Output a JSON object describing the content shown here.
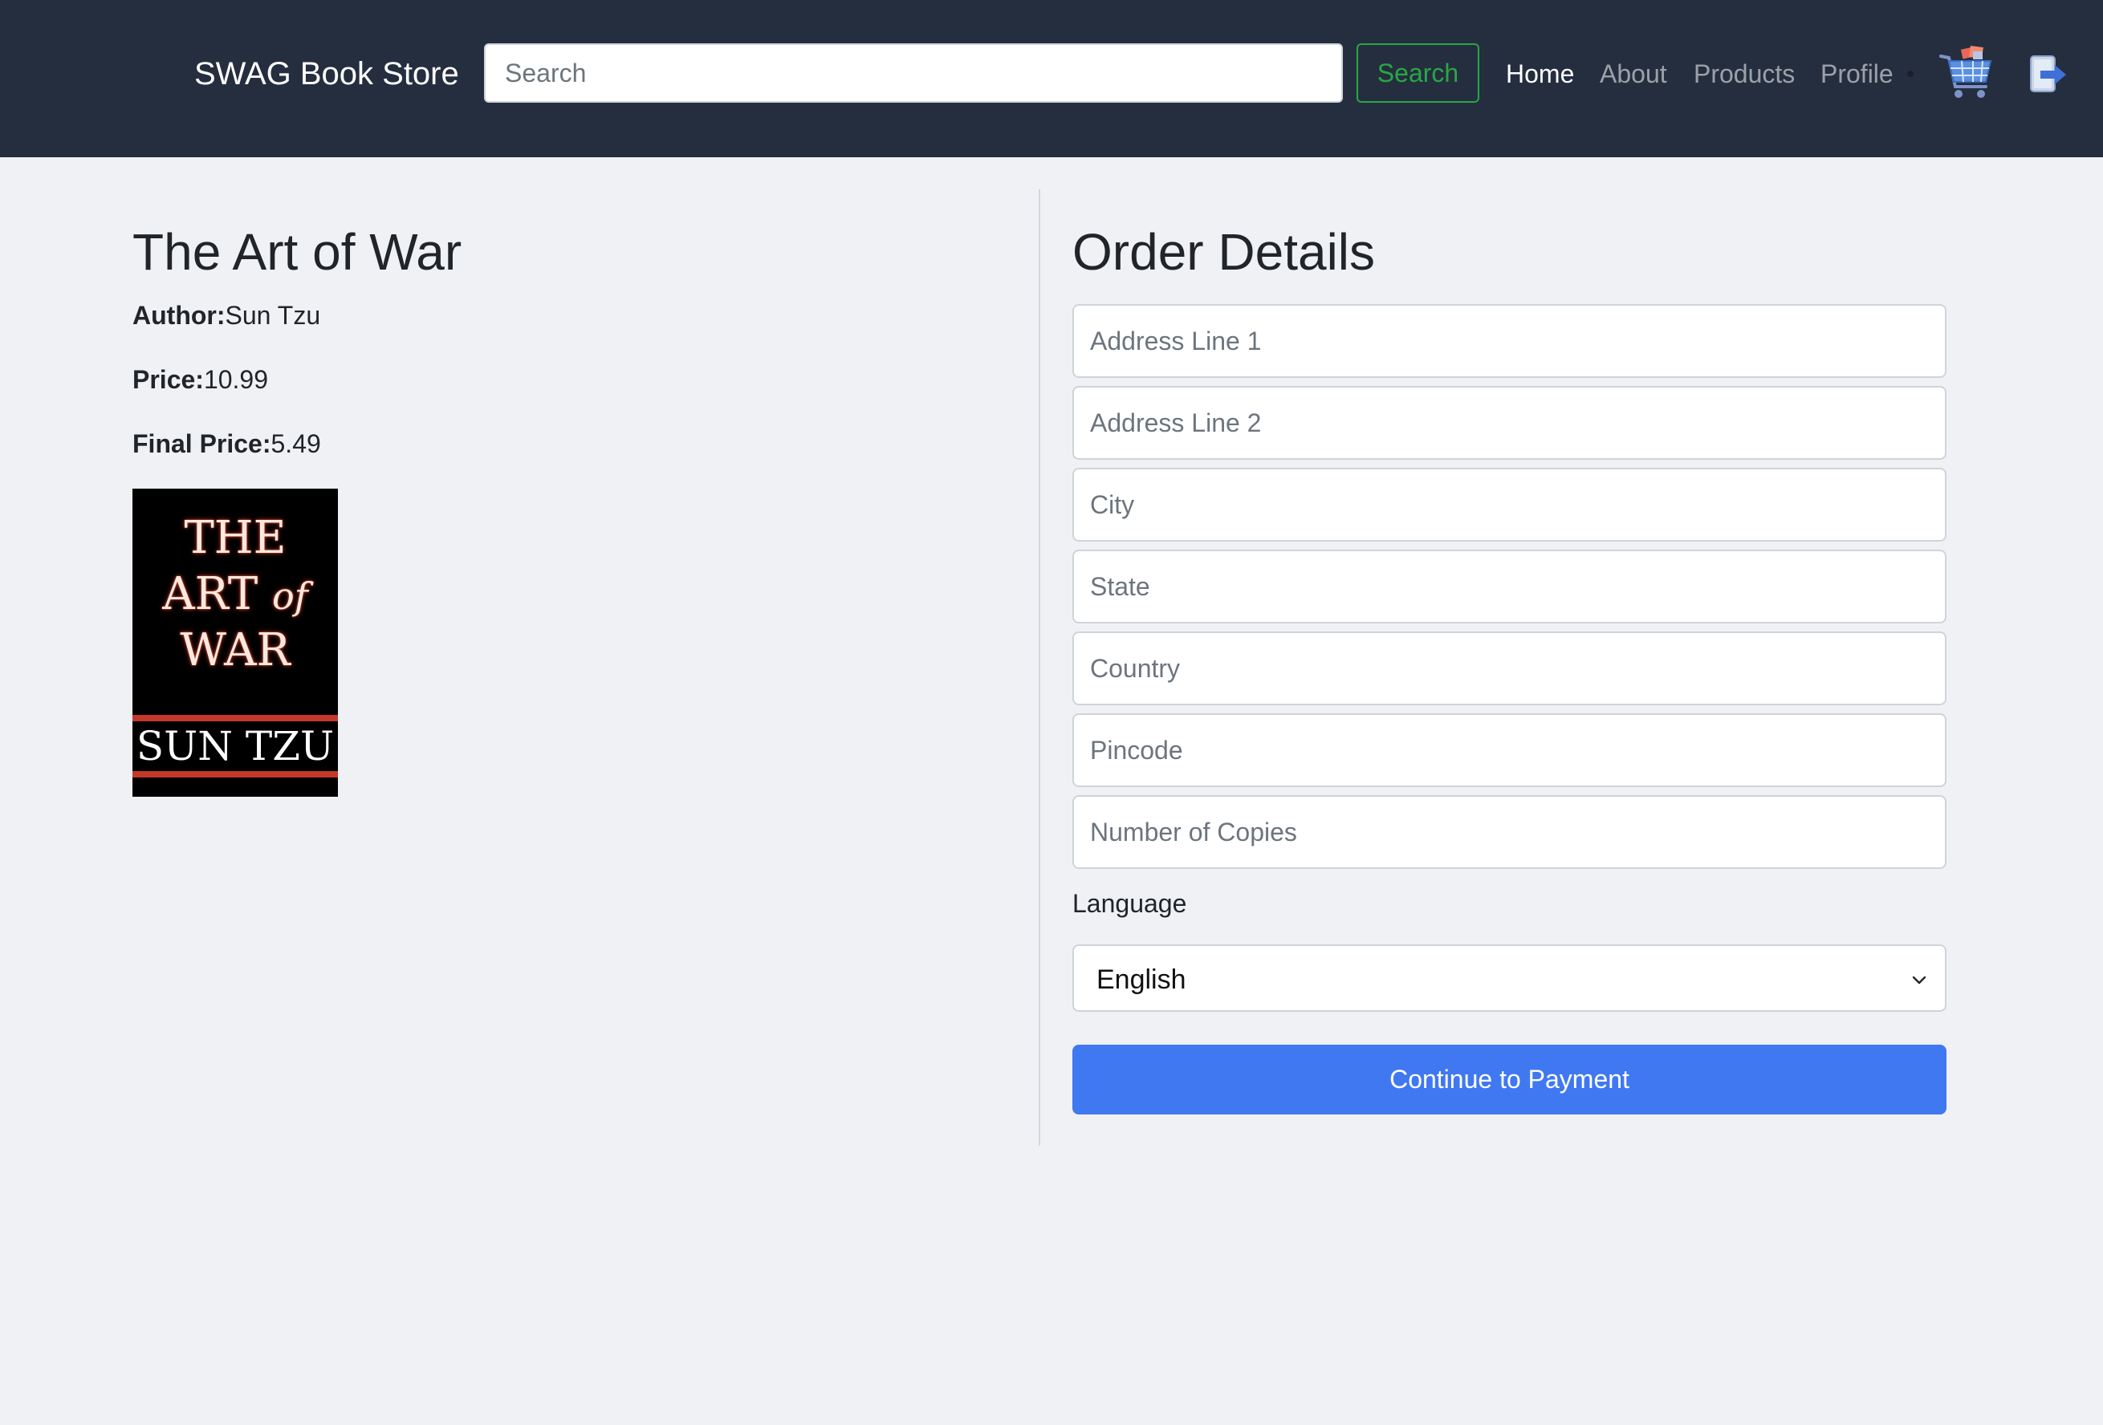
{
  "navbar": {
    "brand": "SWAG Book Store",
    "search_placeholder": "Search",
    "search_button": "Search",
    "links": {
      "home": "Home",
      "about": "About",
      "products": "Products",
      "profile": "Profile"
    },
    "icons": {
      "cart": "shopping-cart-icon",
      "logout": "logout-icon"
    },
    "colors": {
      "background": "#252e3f",
      "search_button": "#28a745"
    }
  },
  "book": {
    "title": "The Art of War",
    "author_label": "Author:",
    "author": "Sun Tzu",
    "price_label": "Price:",
    "price": "10.99",
    "final_price_label": "Final Price:",
    "final_price": "5.49",
    "cover": {
      "line1": "THE",
      "line2a": "ART ",
      "line2b": "of",
      "line3": "WAR",
      "author": "SUN TZU"
    }
  },
  "order": {
    "title": "Order Details",
    "fields": {
      "address1": "Address Line 1",
      "address2": "Address Line 2",
      "city": "City",
      "state": "State",
      "country": "Country",
      "pincode": "Pincode",
      "copies": "Number of Copies"
    },
    "language_label": "Language",
    "language_selected": "English",
    "submit_label": "Continue to Payment",
    "accent_color": "#4078f2"
  }
}
